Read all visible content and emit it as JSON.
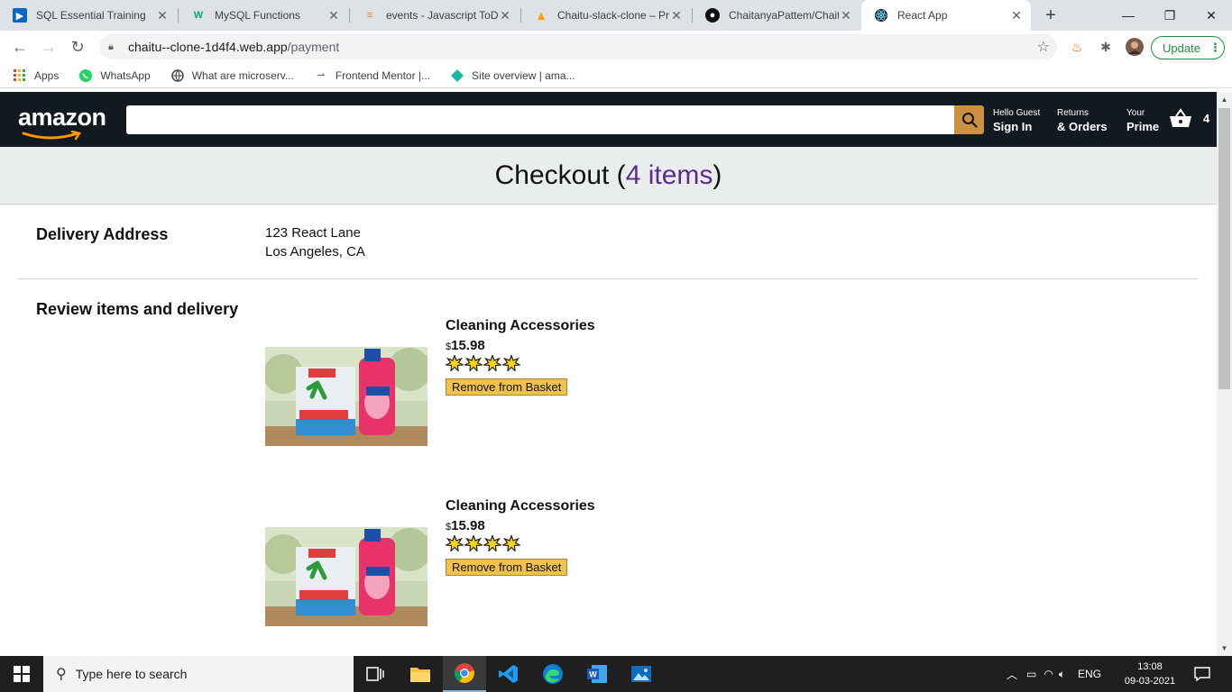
{
  "browser": {
    "tabs": [
      {
        "label": "SQL Essential Training",
        "icon": "linkedin-learning-icon",
        "color": "#0a66c2"
      },
      {
        "label": "MySQL Functions",
        "icon": "w3schools-icon",
        "color": "#04aa6d"
      },
      {
        "label": "events - Javascript ToDo",
        "icon": "stackoverflow-icon",
        "color": "#f48024"
      },
      {
        "label": "Chaitu-slack-clone – Pro",
        "icon": "firebase-icon",
        "color": "#ffa000"
      },
      {
        "label": "ChaitanyaPattem/Chaitu",
        "icon": "github-icon",
        "color": "#111111"
      },
      {
        "label": "React App",
        "icon": "react-icon",
        "color": "#61dafb"
      }
    ],
    "url_host": "chaitu--clone-1d4f4.web.app",
    "url_path": "/payment",
    "update_label": "Update",
    "bookmarks": [
      {
        "label": "Apps",
        "icon": "apps-grid-icon"
      },
      {
        "label": "WhatsApp",
        "icon": "whatsapp-icon"
      },
      {
        "label": "What are microserv...",
        "icon": "globe-icon"
      },
      {
        "label": "Frontend Mentor |...",
        "icon": "frontend-mentor-icon"
      },
      {
        "label": "Site overview | ama...",
        "icon": "diamond-icon"
      }
    ]
  },
  "header": {
    "logo_text": "amazon",
    "search_value": "",
    "options": [
      {
        "line1": "Hello Guest",
        "line2": "Sign In"
      },
      {
        "line1": "Returns",
        "line2": "& Orders"
      },
      {
        "line1": "Your",
        "line2": "Prime"
      }
    ],
    "basket_count": "4"
  },
  "checkout": {
    "title_prefix": "Checkout (",
    "items_text": "4 items",
    "title_suffix": ")"
  },
  "delivery": {
    "title": "Delivery Address",
    "line1": "123 React Lane",
    "line2": "Los Angeles, CA"
  },
  "review": {
    "title": "Review items and delivery"
  },
  "products": [
    {
      "title": "Cleaning Accessories",
      "currency": "$",
      "price": "15.98",
      "rating": 4,
      "button": "Remove from Basket"
    },
    {
      "title": "Cleaning Accessories",
      "currency": "$",
      "price": "15.98",
      "rating": 4,
      "button": "Remove from Basket"
    }
  ],
  "taskbar": {
    "search_placeholder": "Type here to search",
    "language": "ENG",
    "time": "13:08",
    "date": "09-03-2021"
  },
  "colors": {
    "amazon_dark": "#131921",
    "search_button": "#cd9042",
    "checkout_items_link": "#5b2c8a",
    "button_yellow": "#f0c14b"
  }
}
